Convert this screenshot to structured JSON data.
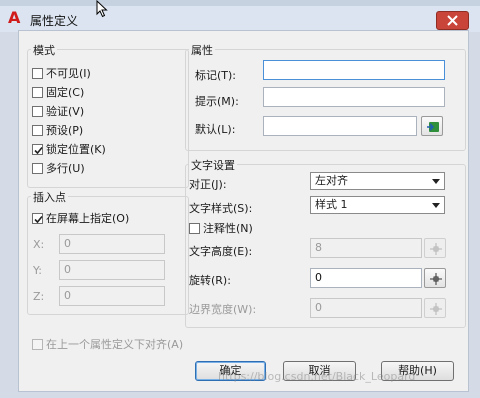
{
  "window": {
    "title": "属性定义"
  },
  "mode": {
    "label": "模式",
    "items": [
      {
        "label": "不可见(I)",
        "checked": false
      },
      {
        "label": "固定(C)",
        "checked": false
      },
      {
        "label": "验证(V)",
        "checked": false
      },
      {
        "label": "预设(P)",
        "checked": false
      },
      {
        "label": "锁定位置(K)",
        "checked": true
      },
      {
        "label": "多行(U)",
        "checked": false
      }
    ]
  },
  "insertion": {
    "label": "插入点",
    "on_screen": {
      "label": "在屏幕上指定(O)",
      "checked": true
    },
    "x": {
      "label": "X:",
      "value": "0"
    },
    "y": {
      "label": "Y:",
      "value": "0"
    },
    "z": {
      "label": "Z:",
      "value": "0"
    }
  },
  "attribute": {
    "label": "属性",
    "tag": {
      "label": "标记(T):",
      "value": ""
    },
    "prompt": {
      "label": "提示(M):",
      "value": ""
    },
    "default": {
      "label": "默认(L):",
      "value": ""
    }
  },
  "text_settings": {
    "label": "文字设置",
    "justification": {
      "label": "对正(J):",
      "value": "左对齐"
    },
    "text_style": {
      "label": "文字样式(S):",
      "value": "样式 1"
    },
    "annotative": {
      "label": "注释性(N)",
      "checked": false
    },
    "text_height": {
      "label": "文字高度(E):",
      "value": "8"
    },
    "rotation": {
      "label": "旋转(R):",
      "value": "0"
    },
    "boundary_width": {
      "label": "边界宽度(W):",
      "value": "0"
    }
  },
  "align_below": {
    "label": "在上一个属性定义下对齐(A)",
    "checked": false
  },
  "buttons": {
    "ok": "确定",
    "cancel": "取消",
    "help": "帮助(H)"
  },
  "watermark": "https://blog.csdn.net/Black_Leopard",
  "colors": {
    "title_bg": "#dbe4f0",
    "close_red": "#c9453a",
    "focus_blue": "#4a90d9"
  }
}
